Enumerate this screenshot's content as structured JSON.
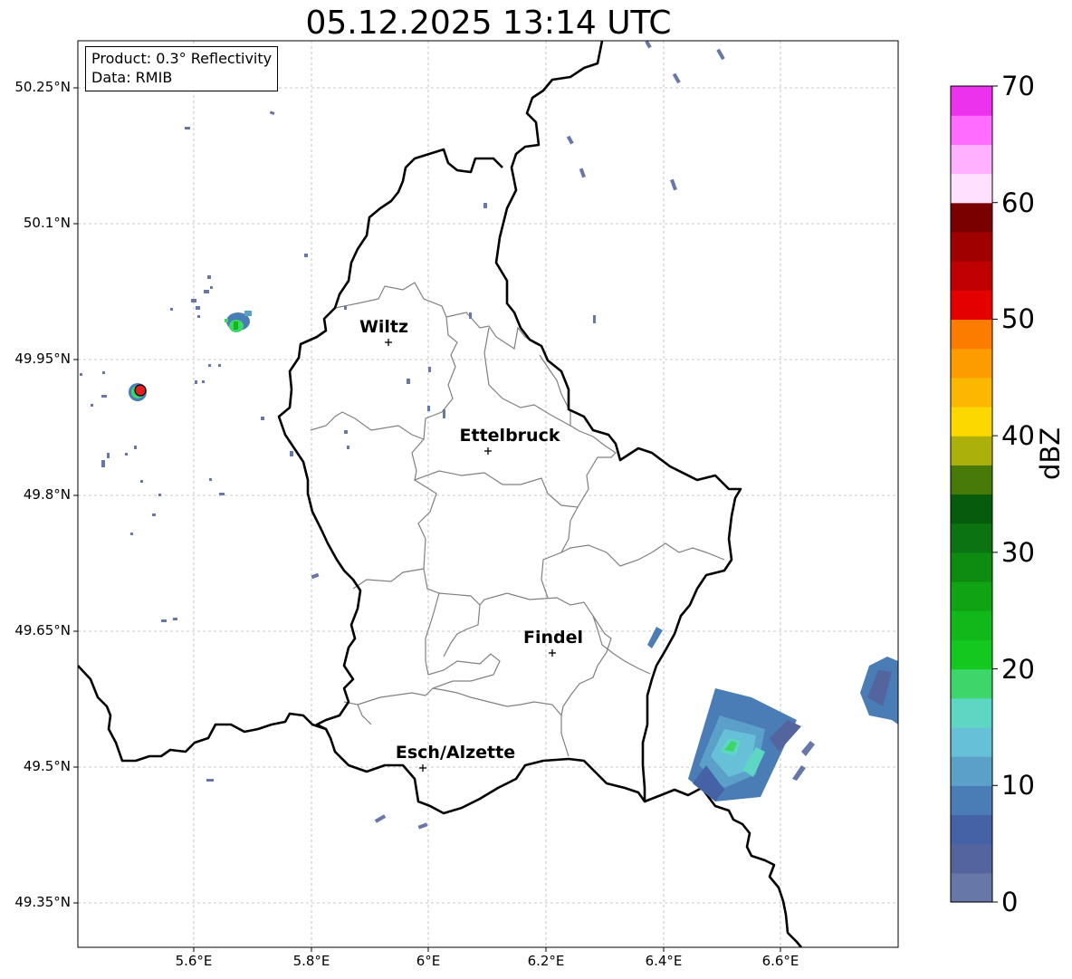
{
  "title": "05.12.2025 13:14 UTC",
  "info": {
    "product": "Product: 0.3° Reflectivity",
    "data": "Data: RMIB"
  },
  "lat_labels": [
    "50.25°N",
    "50.1°N",
    "49.95°N",
    "49.8°N",
    "49.65°N",
    "49.5°N",
    "49.35°N"
  ],
  "lon_labels": [
    "5.6°E",
    "5.8°E",
    "6°E",
    "6.2°E",
    "6.4°E",
    "6.6°E"
  ],
  "cities": [
    "Wiltz",
    "Ettelbruck",
    "Findel",
    "Esch/Alzette"
  ],
  "colorbar": {
    "label": "dBZ",
    "ticks": [
      "0",
      "10",
      "20",
      "30",
      "40",
      "50",
      "60",
      "70"
    ],
    "colors": [
      "#6677a8",
      "#53649e",
      "#4462a5",
      "#4a7cb5",
      "#5aa0c8",
      "#66c0d8",
      "#5ed6c4",
      "#3dd66a",
      "#15c820",
      "#12b81a",
      "#10a414",
      "#0e8c12",
      "#0b7410",
      "#065c0c",
      "#487a0a",
      "#acb00a",
      "#fcd800",
      "#fcb800",
      "#fc9c00",
      "#fc7c00",
      "#e40000",
      "#c00000",
      "#a00000",
      "#7a0000",
      "#ffe0ff",
      "#ffb0ff",
      "#ff6cff",
      "#ec32ec"
    ]
  },
  "radar_site": {
    "color": "#e02020"
  },
  "boundary_color": "#000000",
  "canton_color": "#808080"
}
